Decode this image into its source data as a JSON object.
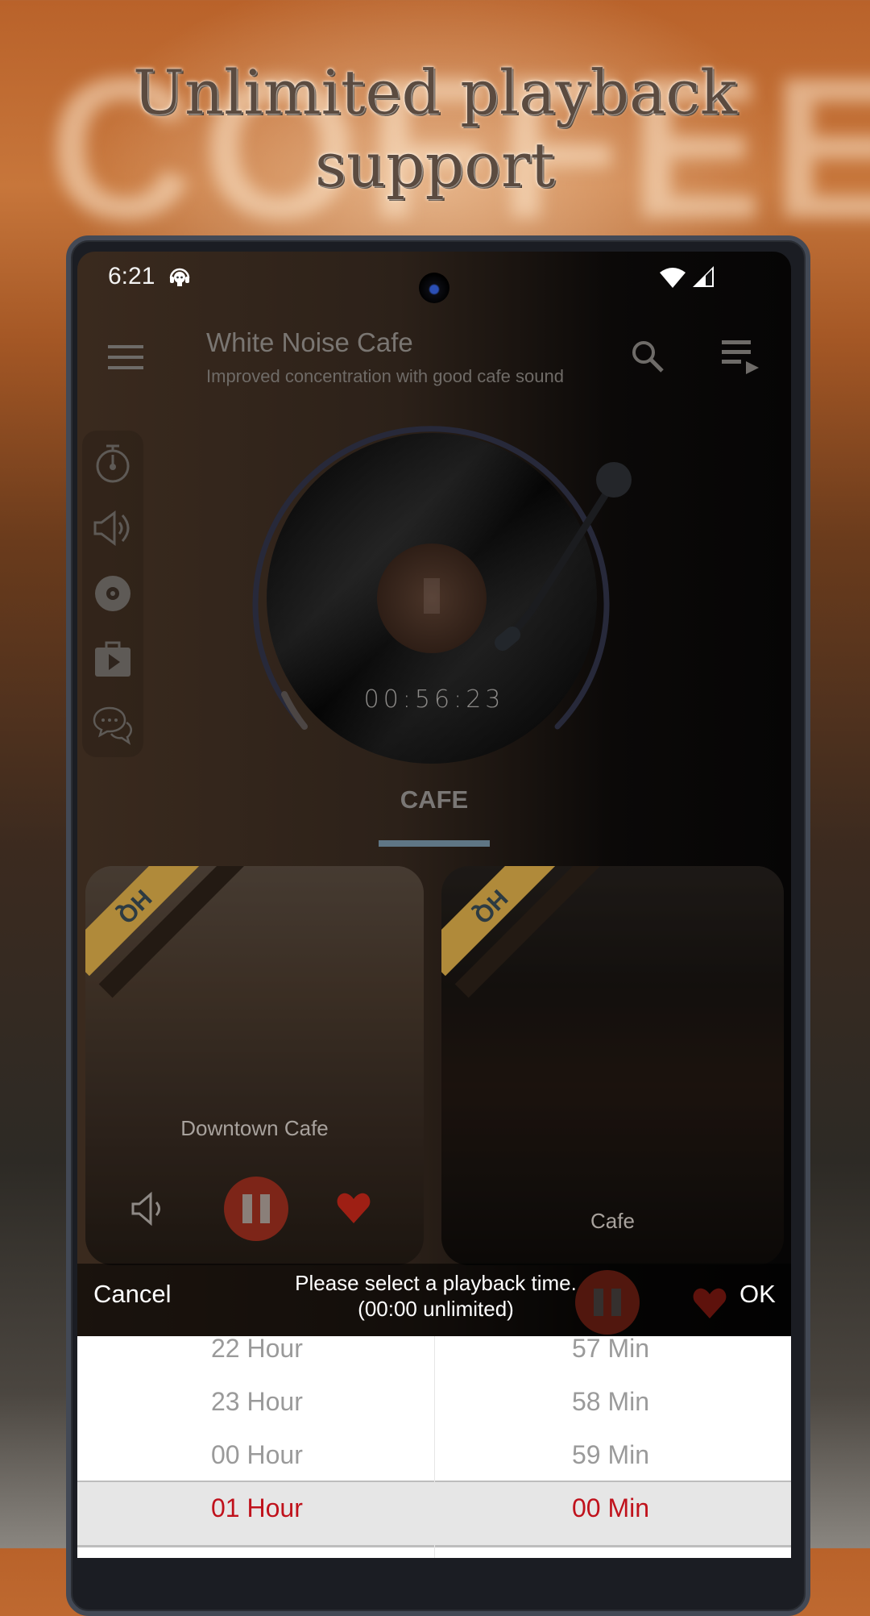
{
  "promo": {
    "background_word": "COFFEE",
    "headline_line1": "Unlimited playback",
    "headline_line2": "support"
  },
  "status_bar": {
    "time": "6:21",
    "notification_icon": "podcast-headphones-icon",
    "wifi_icon": "wifi-icon",
    "signal_icon": "cell-signal-icon"
  },
  "app_bar": {
    "title": "White Noise Cafe",
    "subtitle": "Improved concentration with good cafe sound",
    "menu_icon": "hamburger-menu-icon",
    "search_icon": "search-icon",
    "playlist_icon": "playlist-play-icon"
  },
  "side_rail": {
    "items": [
      {
        "name": "sleep-timer",
        "icon": "stopwatch-icon"
      },
      {
        "name": "volume",
        "icon": "speaker-icon"
      },
      {
        "name": "disc",
        "icon": "disc-icon"
      },
      {
        "name": "play-store",
        "icon": "store-bag-icon"
      },
      {
        "name": "feedback",
        "icon": "chat-bubbles-icon"
      }
    ]
  },
  "player": {
    "elapsed_time": "00:56:23",
    "progress_fraction": 0.1
  },
  "category_tab": {
    "label": "CAFE"
  },
  "cards": [
    {
      "title": "Downtown Cafe",
      "badge": "HQ",
      "playing": true,
      "favorite": true
    },
    {
      "title": "Cafe",
      "badge": "HQ",
      "playing": true,
      "favorite": true
    }
  ],
  "colors": {
    "accent_red": "#c0121c",
    "tab_indicator": "#5f7685",
    "badge_gold": "#b08a3a"
  },
  "time_picker": {
    "cancel_label": "Cancel",
    "ok_label": "OK",
    "prompt_line1": "Please select a playback time.",
    "prompt_line2": "(00:00 unlimited)",
    "hours": [
      "22 Hour",
      "23 Hour",
      "00 Hour",
      "01 Hour"
    ],
    "minutes": [
      "57 Min",
      "58 Min",
      "59 Min",
      "00 Min"
    ],
    "selected_hour": "01 Hour",
    "selected_minute": "00 Min"
  }
}
